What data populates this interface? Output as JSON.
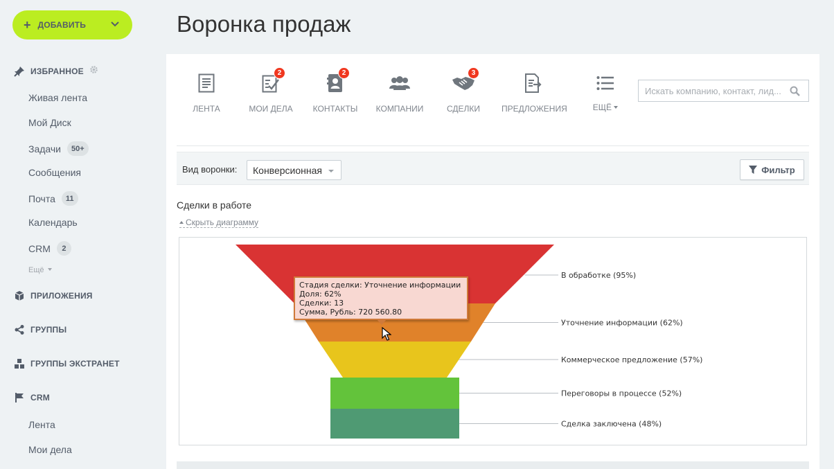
{
  "sidebar": {
    "add_label": "ДОБАВИТЬ",
    "favorites_label": "ИЗБРАННОЕ",
    "items": [
      {
        "label": "Живая лента",
        "badge": ""
      },
      {
        "label": "Мой Диск",
        "badge": ""
      },
      {
        "label": "Задачи",
        "badge": "50+"
      },
      {
        "label": "Сообщения",
        "badge": ""
      },
      {
        "label": "Почта",
        "badge": "11"
      },
      {
        "label": "Календарь",
        "badge": ""
      },
      {
        "label": "CRM",
        "badge": "2"
      }
    ],
    "more_label": "Ещё",
    "sections": {
      "apps": "ПРИЛОЖЕНИЯ",
      "groups": "ГРУППЫ",
      "extranet": "ГРУППЫ ЭКСТРАНЕТ",
      "crm": "CRM"
    },
    "crm_items": [
      {
        "label": "Лента"
      },
      {
        "label": "Мои дела"
      }
    ]
  },
  "page_title": "Воронка продаж",
  "toolbar": {
    "items": [
      {
        "label": "ЛЕНТА",
        "count": "",
        "icon": "feed-icon"
      },
      {
        "label": "МОИ ДЕЛА",
        "count": "2",
        "icon": "tasks-icon"
      },
      {
        "label": "КОНТАКТЫ",
        "count": "2",
        "icon": "contacts-icon"
      },
      {
        "label": "КОМПАНИИ",
        "count": "",
        "icon": "companies-icon"
      },
      {
        "label": "СДЕЛКИ",
        "count": "3",
        "icon": "deals-icon"
      },
      {
        "label": "ПРЕДЛОЖЕНИЯ",
        "count": "",
        "icon": "quotes-icon"
      },
      {
        "label": "ЕЩЁ",
        "count": "",
        "icon": "more-list-icon"
      }
    ],
    "search_placeholder": "Искать компанию, контакт, лид..."
  },
  "filterbar": {
    "funnel_label": "Вид воронки:",
    "funnel_value": "Конверсионная",
    "filter_label": "Фильтр"
  },
  "section": {
    "title": "Сделки в работе",
    "hide_link": "Скрыть диаграмму"
  },
  "chart_data": {
    "type": "funnel",
    "stages": [
      {
        "name": "В обработке",
        "percent": 95,
        "label": "В обработке (95%)",
        "color": "#d93333"
      },
      {
        "name": "Уточнение информации",
        "percent": 62,
        "label": "Уточнение информации (62%)",
        "color": "#e0822a"
      },
      {
        "name": "Коммерческое предложение",
        "percent": 57,
        "label": "Коммерческое предложение (57%)",
        "color": "#e8c51c"
      },
      {
        "name": "Переговоры в процессе",
        "percent": 52,
        "label": "Переговоры в процессе (52%)",
        "color": "#63c33b"
      },
      {
        "name": "Сделка заключена",
        "percent": 48,
        "label": "Сделка заключена (48%)",
        "color": "#4f9a73"
      }
    ],
    "tooltip": {
      "line1": "Стадия сделки: Уточнение информации",
      "line2": "Доля: 62%",
      "line3": "Сделки: 13",
      "line4": "Сумма, Рубль: 720 560.80"
    }
  }
}
